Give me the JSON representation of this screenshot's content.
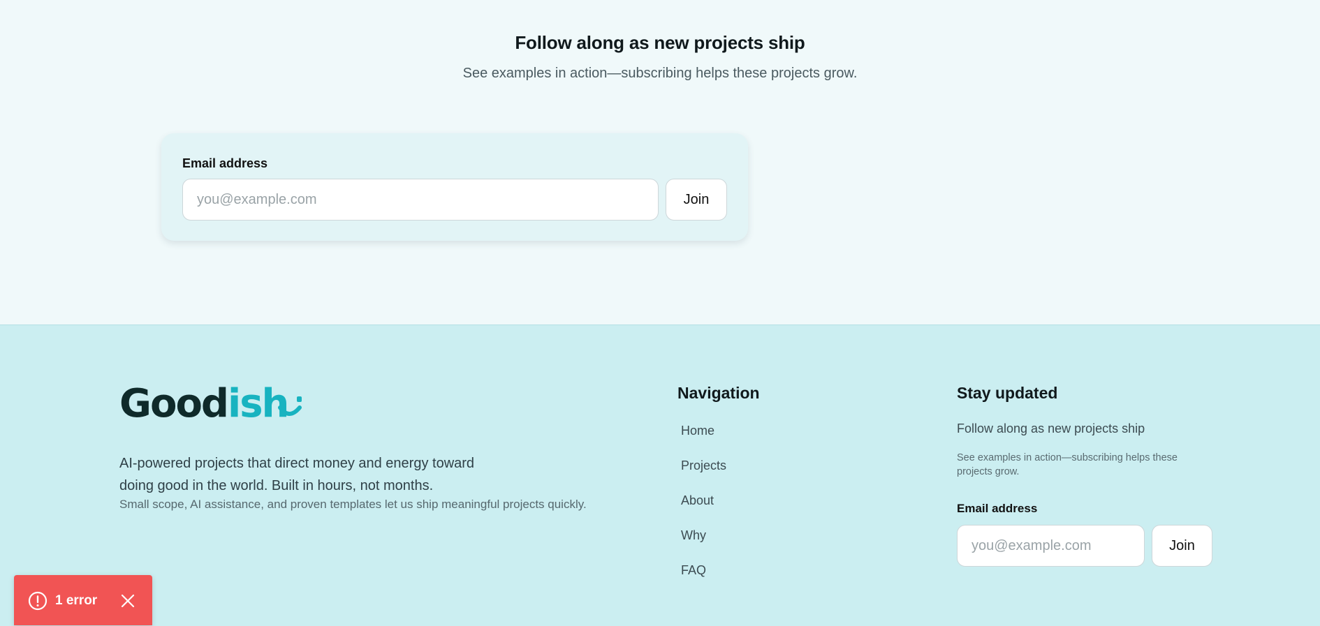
{
  "subscribe": {
    "title": "Follow along as new projects ship",
    "subtitle": "See examples in action—subscribing helps these projects grow.",
    "email_label": "Email address",
    "email_placeholder": "you@example.com",
    "email_value": "",
    "join_label": "Join"
  },
  "footer": {
    "logo": {
      "part1": "Good",
      "part2": "ish",
      "icon": "smile-icon"
    },
    "tagline": "AI-powered projects that direct money and energy toward doing good in the world. Built in hours, not months.",
    "note": "Small scope, AI assistance, and proven templates let us ship meaningful projects quickly.",
    "navigation": {
      "heading": "Navigation",
      "items": [
        {
          "label": "Home"
        },
        {
          "label": "Projects"
        },
        {
          "label": "About"
        },
        {
          "label": "Why"
        },
        {
          "label": "FAQ"
        }
      ]
    },
    "stay_updated": {
      "heading": "Stay updated",
      "subtitle": "Follow along as new projects ship",
      "note": "See examples in action—subscribing helps these projects grow.",
      "email_label": "Email address",
      "email_placeholder": "you@example.com",
      "email_value": "",
      "join_label": "Join"
    }
  },
  "error_toast": {
    "text": "1 error",
    "icon": "alert-circle-icon",
    "close_icon": "close-icon"
  },
  "colors": {
    "page_bg": "#f0f9fa",
    "footer_bg": "#cbeef1",
    "brand_dark": "#0f2a2a",
    "brand_accent": "#18b3c0",
    "error": "#f15454"
  }
}
